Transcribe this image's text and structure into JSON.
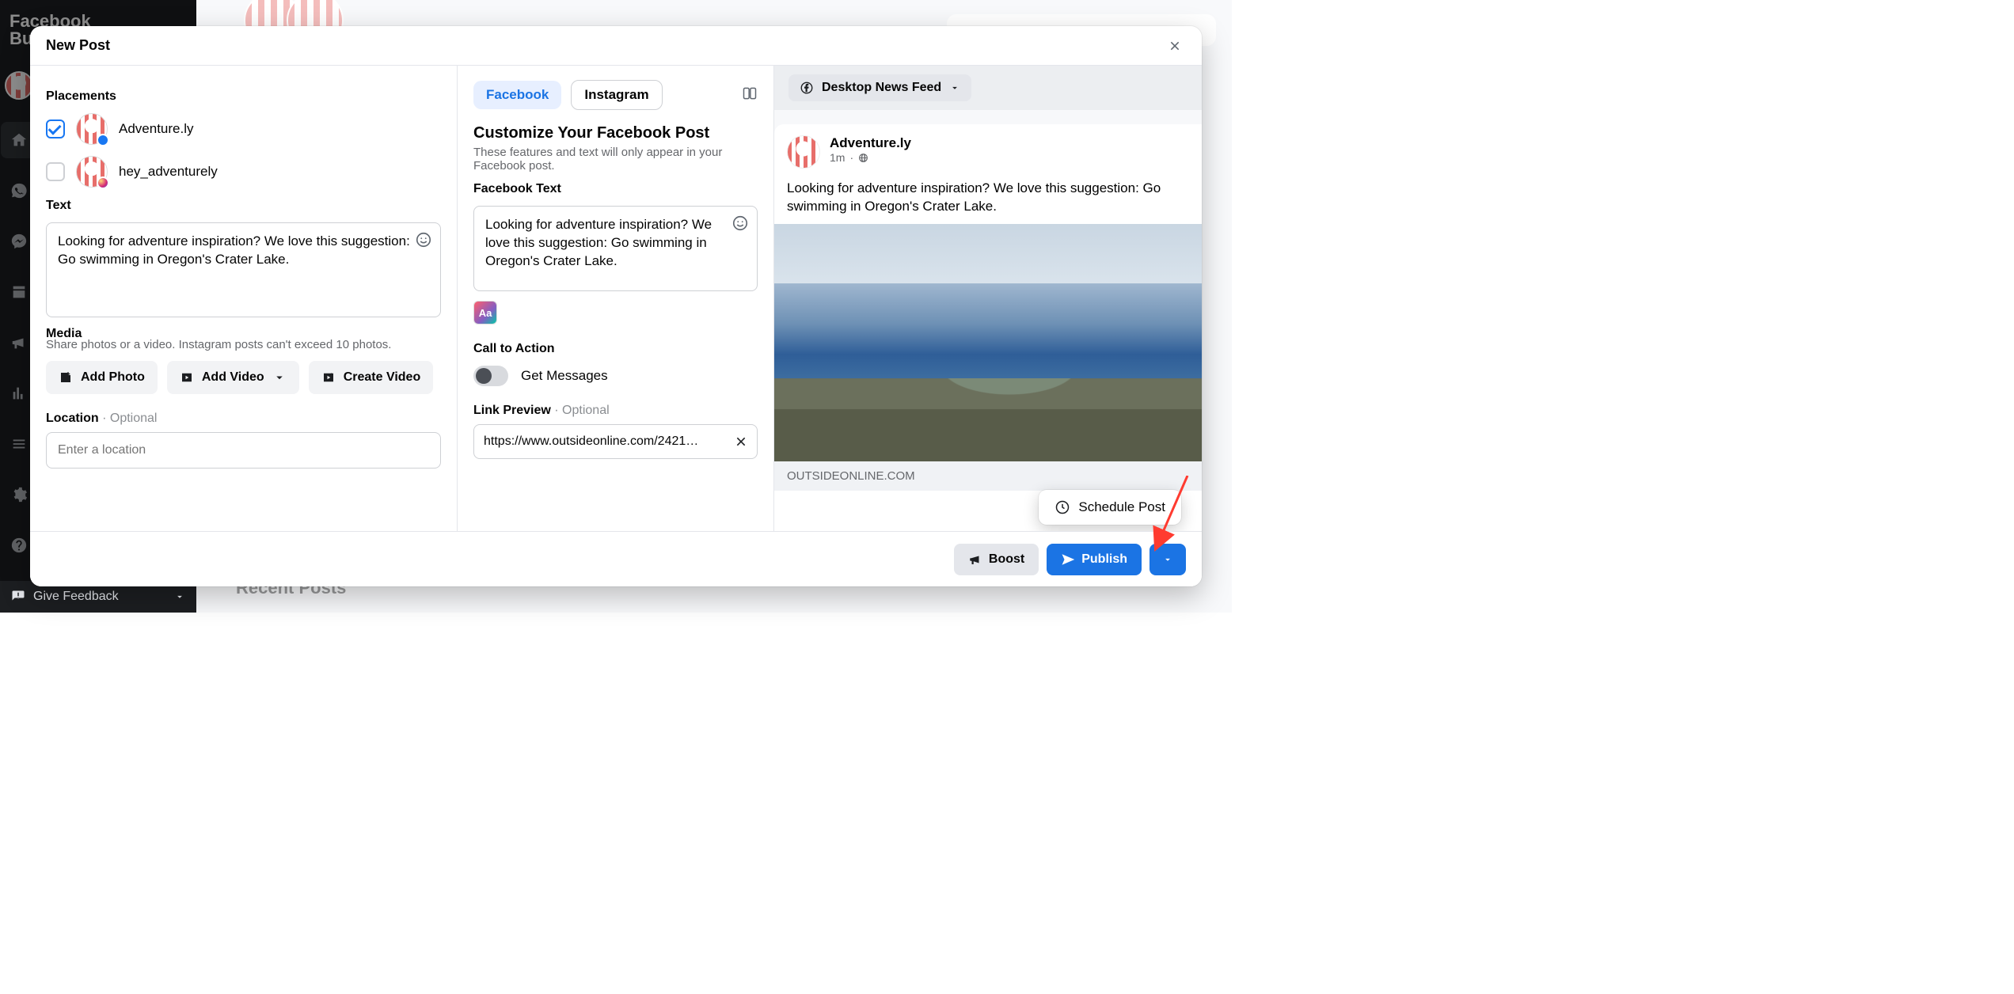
{
  "app": {
    "brand": "Facebook\nBusiness"
  },
  "background": {
    "recent_posts": "Recent Posts",
    "give_feedback": "Give Feedback"
  },
  "modal": {
    "title": "New Post",
    "placements": {
      "label": "Placements",
      "items": [
        {
          "name": "Adventure.ly",
          "network": "facebook",
          "checked": true
        },
        {
          "name": "hey_adventurely",
          "network": "instagram",
          "checked": false
        }
      ]
    },
    "text": {
      "label": "Text",
      "value": "Looking for adventure inspiration? We love this suggestion: Go swimming in Oregon's Crater Lake."
    },
    "media": {
      "label": "Media",
      "sub": "Share photos or a video. Instagram posts can't exceed 10 photos.",
      "add_photo": "Add Photo",
      "add_video": "Add Video",
      "create_video": "Create Video"
    },
    "location": {
      "label": "Location",
      "optional": " · Optional",
      "placeholder": "Enter a location"
    },
    "customize": {
      "tab_fb": "Facebook",
      "tab_ig": "Instagram",
      "heading": "Customize Your Facebook Post",
      "sub": "These features and text will only appear in your Facebook post.",
      "fb_text_label": "Facebook Text",
      "fb_text_value": "Looking for adventure inspiration? We love this suggestion: Go swimming in Oregon's Crater Lake.",
      "cta_label": "Call to Action",
      "cta_option": "Get Messages",
      "link_label": "Link Preview",
      "link_optional": " · Optional",
      "link_value": "https://www.outsideonline.com/2421…"
    },
    "preview": {
      "selector": "Desktop News Feed",
      "page_name": "Adventure.ly",
      "meta_time": "1m",
      "body": "Looking for adventure inspiration? We love this suggestion: Go swimming in Oregon's Crater Lake.",
      "link_domain": "OUTSIDEONLINE.COM"
    },
    "footer": {
      "boost": "Boost",
      "publish": "Publish",
      "schedule_popover": "Schedule Post"
    }
  }
}
